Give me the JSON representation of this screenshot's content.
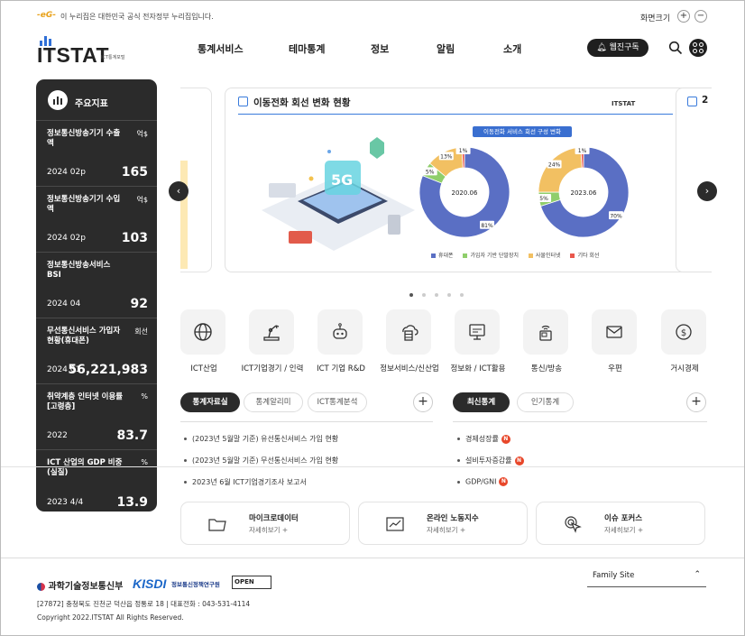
{
  "gov_banner": {
    "logo": "-eG-",
    "text": "이 누리집은 대한민국 공식 전자정부 누리집입니다.",
    "zoom_label": "화면크기",
    "zoom_in": "+",
    "zoom_out": "−"
  },
  "header": {
    "brand_name": "ITSTAT",
    "brand_sub": "ICT통계포털",
    "nav": [
      "통계서비스",
      "테마통계",
      "정보",
      "알림",
      "소개"
    ],
    "webzine": "웹진구독",
    "search_icon": "search-icon",
    "menu_icon": "apps-icon"
  },
  "kpi": {
    "title": "주요지표",
    "items": [
      {
        "name": "정보통신방송기기 수출액",
        "unit": "억$",
        "date": "2024 02p",
        "value": "165"
      },
      {
        "name": "정보통신방송기기 수입액",
        "unit": "억$",
        "date": "2024 02p",
        "value": "103"
      },
      {
        "name": "정보통신방송서비스 BSI",
        "unit": "",
        "date": "2024 04",
        "value": "92"
      },
      {
        "name": "무선통신서비스 가입자 현황(휴대폰)",
        "unit": "회선",
        "date": "2024 01",
        "value": "56,221,983"
      },
      {
        "name": "취약계층 인터넷 이용률 [고령층]",
        "unit": "%",
        "date": "2022",
        "value": "83.7"
      },
      {
        "name": "ICT 산업의 GDP 비중 (실질)",
        "unit": "%",
        "date": "2023 4/4",
        "value": "13.9"
      }
    ]
  },
  "slider": {
    "title": "이동전화 회선 변화 현황",
    "watermark": "ITSTAT",
    "caption": "이동전화 서비스 회선 구성 변화",
    "next_peek_title": "2",
    "prev_label": "‹",
    "next_label": "›",
    "legend": [
      "휴대폰",
      "가입자 기반 단말장치",
      "사물인터넷",
      "기타 회선"
    ],
    "colors": {
      "phone": "#5a6fc4",
      "device": "#8fce6b",
      "iot": "#f2c062",
      "etc": "#e9574c"
    },
    "donuts": [
      {
        "label": "2020.06",
        "segments": [
          {
            "key": "phone",
            "pct": 81,
            "text": "81%"
          },
          {
            "key": "device",
            "pct": 5,
            "text": "5%"
          },
          {
            "key": "iot",
            "pct": 13,
            "text": "13%"
          },
          {
            "key": "etc",
            "pct": 1,
            "text": "1%"
          }
        ]
      },
      {
        "label": "2023.06",
        "segments": [
          {
            "key": "phone",
            "pct": 70,
            "text": "70%"
          },
          {
            "key": "device",
            "pct": 5,
            "text": "5%"
          },
          {
            "key": "iot",
            "pct": 24,
            "text": "24%"
          },
          {
            "key": "etc",
            "pct": 1,
            "text": "1%"
          }
        ]
      }
    ],
    "page_count": 5,
    "active_page": 0
  },
  "categories": [
    {
      "label": "ICT산업",
      "icon": "globe-icon"
    },
    {
      "label": "ICT기업경기 / 인력",
      "icon": "robot-arm-icon"
    },
    {
      "label": "ICT 기업 R&D",
      "icon": "robot-icon"
    },
    {
      "label": "정보서비스/신산업",
      "icon": "cloud-server-icon"
    },
    {
      "label": "정보화 / ICT활용",
      "icon": "monitor-icon"
    },
    {
      "label": "통신/방송",
      "icon": "wireless-device-icon"
    },
    {
      "label": "우편",
      "icon": "mail-icon"
    },
    {
      "label": "거시경제",
      "icon": "money-icon"
    }
  ],
  "left_tabs": {
    "tabs": [
      "통계자료실",
      "통계알리미",
      "ICT통계분석"
    ],
    "active": 0,
    "more": "+",
    "items": [
      "(2023년 5월말 기준) 유선통신서비스 가입 현황",
      "(2023년 5월말 기준) 무선통신서비스 가입 현황",
      "2023년 6월 ICT기업경기조사 보고서"
    ]
  },
  "right_tabs": {
    "tabs": [
      "최신통계",
      "인기통계"
    ],
    "active": 0,
    "more": "+",
    "items": [
      "경제성장률",
      "설비투자증감률",
      "GDP/GNI"
    ],
    "new_badge": "N"
  },
  "quick_links": [
    {
      "title": "마이크로데이터",
      "sub": "자세히보기 +",
      "icon": "folder-icon"
    },
    {
      "title": "온라인 노동지수",
      "sub": "자세히보기 +",
      "icon": "trend-chart-icon"
    },
    {
      "title": "이슈 포커스",
      "sub": "자세히보기 +",
      "icon": "cursor-click-icon"
    }
  ],
  "footer": {
    "ministry": "과학기술정보통신부",
    "kisdi": "KISDI",
    "kisdi_name": "정보통신정책연구원",
    "open_badge": "OPEN",
    "family_site": "Family Site",
    "family_caret": "⌃",
    "address": "[27872] 충청북도 진천군 덕산읍 정통로 18  |  대표전화 : 043-531-4114",
    "copyright": "Copyright 2022.ITSTAT All Rights Reserved."
  }
}
